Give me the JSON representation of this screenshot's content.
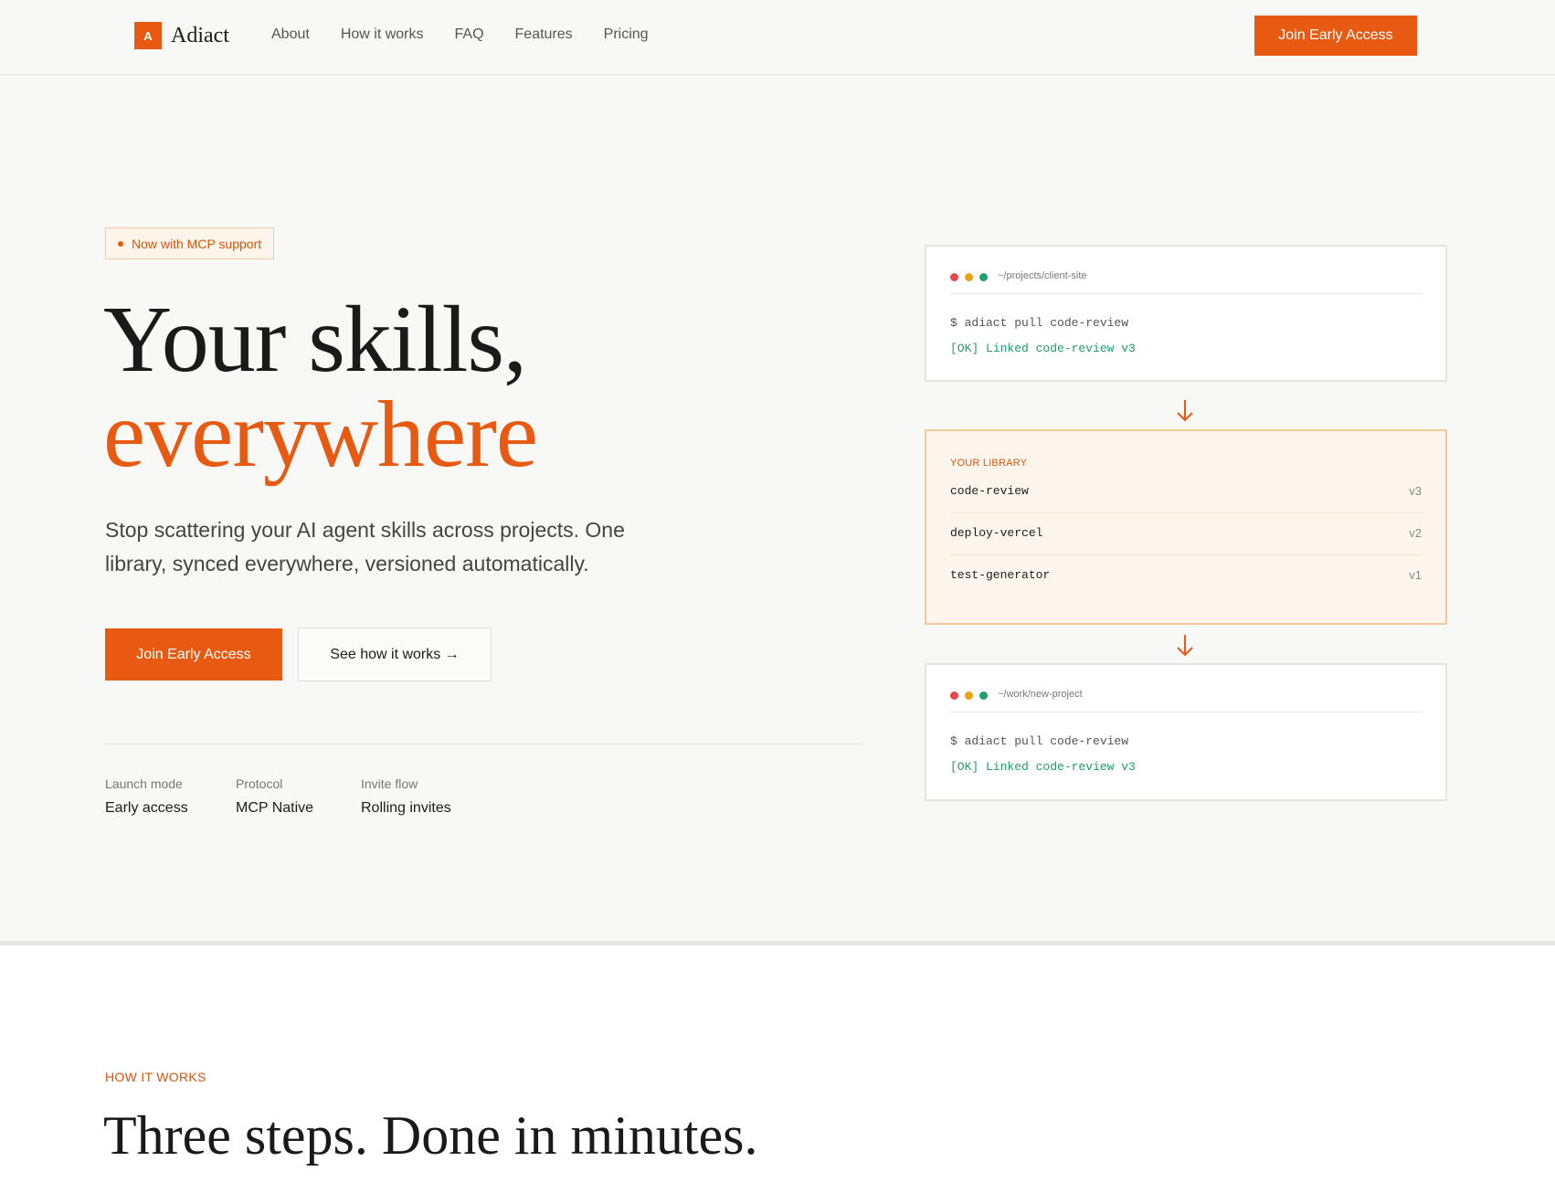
{
  "brand": {
    "logo_letter": "A",
    "name": "Adiact",
    "accent_color": "#e85a12"
  },
  "nav": {
    "links": [
      "About",
      "How it works",
      "FAQ",
      "Features",
      "Pricing"
    ],
    "cta": "Join Early Access"
  },
  "hero": {
    "badge": "Now with MCP support",
    "title_line1": "Your skills,",
    "title_line2": "everywhere",
    "subtitle": "Stop scattering your AI agent skills across projects. One library, synced everywhere, versioned automatically.",
    "primary_cta": "Join Early Access",
    "secondary_cta": "See how it works →",
    "stats": [
      {
        "label": "Launch mode",
        "value": "Early access"
      },
      {
        "label": "Protocol",
        "value": "MCP Native"
      },
      {
        "label": "Invite flow",
        "value": "Rolling invites"
      }
    ]
  },
  "diagram": {
    "terminal_top": {
      "path": "~/projects/client-site",
      "command": "$ adiact pull code-review",
      "result": "[OK] Linked code-review v3"
    },
    "library": {
      "title": "YOUR LIBRARY",
      "items": [
        {
          "name": "code-review",
          "version": "v3"
        },
        {
          "name": "deploy-vercel",
          "version": "v2"
        },
        {
          "name": "test-generator",
          "version": "v1"
        }
      ]
    },
    "terminal_bottom": {
      "path": "~/work/new-project",
      "command": "$ adiact pull code-review",
      "result": "[OK] Linked code-review v3"
    },
    "arrow_icon": "arrow-down-icon"
  },
  "how_it_works": {
    "label": "HOW IT WORKS",
    "title": "Three steps. Done in minutes."
  }
}
